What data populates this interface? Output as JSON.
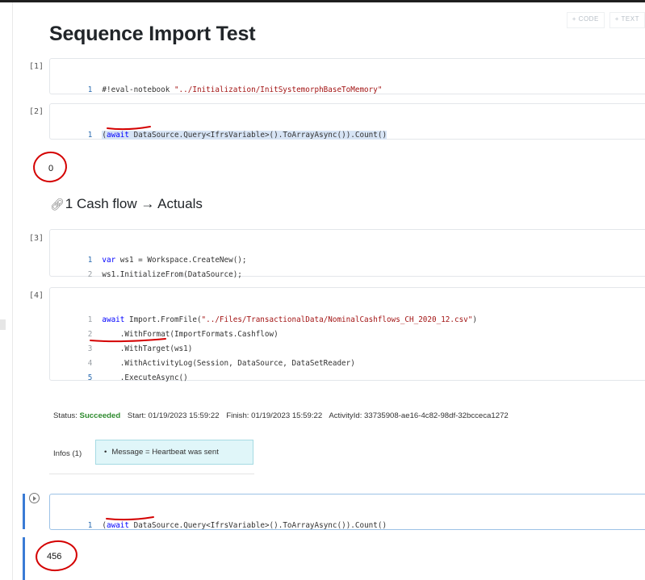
{
  "toolbar": {
    "code_label": "+ CODE",
    "text_label": "+ TEXT"
  },
  "title": "Sequence Import Test",
  "cells": {
    "c1": {
      "prompt": "[1]",
      "lines": [
        {
          "num": "1",
          "pre": "#!eval-notebook ",
          "str": "\"../Initialization/InitSystemorphBaseToMemory\""
        }
      ]
    },
    "c2": {
      "prompt": "[2]",
      "line": {
        "num": "1",
        "open": "(",
        "kw": "await",
        "sp": " ",
        "ds": "DataSource",
        "rest": ".Query<IfrsVariable>().ToArrayAsync()).Count()"
      },
      "output": "0"
    },
    "c3": {
      "prompt": "[3]",
      "lines": [
        {
          "num": "1",
          "kw": "var",
          "rest": " ws1 = Workspace.CreateNew();"
        },
        {
          "num": "2",
          "rest": "ws1.InitializeFrom(DataSource);"
        }
      ]
    },
    "c4": {
      "prompt": "[4]",
      "lines": [
        {
          "num": "1",
          "kw": "await",
          "rest": " Import.FromFile(",
          "str": "\"../Files/TransactionalData/NominalCashflows_CH_2020_12.csv\"",
          "tail": ")"
        },
        {
          "num": "2",
          "rest": "    .WithFormat(ImportFormats.Cashflow)"
        },
        {
          "num": "3",
          "rest": "    .WithTarget(ws1)"
        },
        {
          "num": "4",
          "rest": "    .WithActivityLog(Session, DataSource, DataSetReader)"
        },
        {
          "num": "5",
          "rest": "    .ExecuteAsync()"
        }
      ]
    },
    "c5": {
      "line": {
        "num": "1",
        "open": "(",
        "kw": "await",
        "sp": " ",
        "ds": "DataSource",
        "rest": ".Query<IfrsVariable>().ToArrayAsync()).Count()"
      },
      "output": "456"
    }
  },
  "section_heading": {
    "icon": "🔗︎",
    "text": "1 Cash flow → Actuals"
  },
  "status": {
    "label": "Status:",
    "value": "Succeeded",
    "start_label": "Start:",
    "start_value": "01/19/2023 15:59:22",
    "finish_label": "Finish:",
    "finish_value": "01/19/2023 15:59:22",
    "activity_label": "ActivityId:",
    "activity_value": "33735908-ae16-4c82-98df-32bcceca1272",
    "success_color": "#2e8b2e"
  },
  "infos": {
    "label": "Infos (1)",
    "message": "Message = Heartbeat was sent",
    "bullet": "•"
  },
  "annotation_color": "#d40000"
}
